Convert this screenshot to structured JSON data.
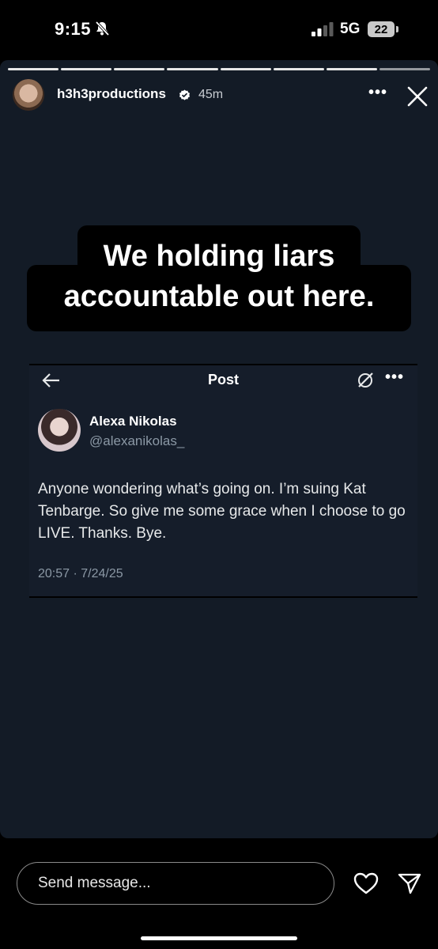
{
  "status_bar": {
    "time": "9:15",
    "network": "5G",
    "battery": "22"
  },
  "story": {
    "progress_segments": 8,
    "username": "h3h3productions",
    "time_ago": "45m",
    "more_label": "•••",
    "caption_line1": "We holding liars",
    "caption_line2": "accountable out here."
  },
  "tweet": {
    "header_title": "Post",
    "more_label": "•••",
    "author_name": "Alexa Nikolas",
    "author_handle": "@alexanikolas_",
    "text": "Anyone wondering what’s going on. I’m suing Kat Tenbarge. So give me some grace when I choose to go LIVE. Thanks. Bye.",
    "date": "20:57 · 7/24/25"
  },
  "reply": {
    "placeholder": "Send message..."
  },
  "colors": {
    "card_bg": "#131b26",
    "tweet_bg": "#151d2a",
    "muted": "#8b98a5"
  }
}
